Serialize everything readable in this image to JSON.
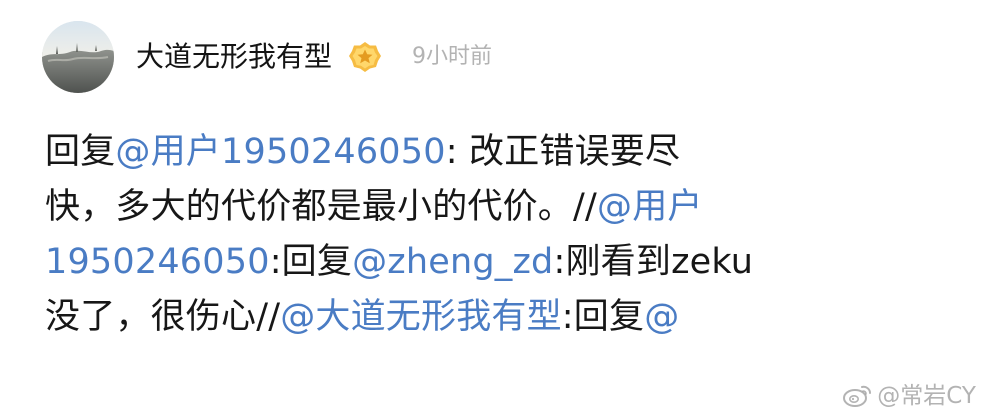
{
  "post": {
    "username": "大道无形我有型",
    "time": "9小时前",
    "badge_icon": "gold-vip-badge-icon",
    "comment_lines": [
      [
        {
          "text": "回复",
          "type": "text"
        },
        {
          "text": "@用户1950246050",
          "type": "mention"
        },
        {
          "text": ": 改正错误要尽",
          "type": "text"
        }
      ],
      [
        {
          "text": "快，多大的代价都是最小的代价。//",
          "type": "text"
        },
        {
          "text": "@用户",
          "type": "mention"
        }
      ],
      [
        {
          "text": "1950246050",
          "type": "mention"
        },
        {
          "text": ":回复",
          "type": "text"
        },
        {
          "text": "@zheng_zd",
          "type": "mention"
        },
        {
          "text": ":刚看到zeku",
          "type": "text"
        }
      ],
      [
        {
          "text": "没了，很伤心//",
          "type": "text"
        },
        {
          "text": "@大道无形我有型",
          "type": "mention"
        },
        {
          "text": ":回复",
          "type": "text"
        },
        {
          "text": "@",
          "type": "mention"
        }
      ]
    ]
  },
  "watermark": {
    "text": "@常岩CY",
    "icon": "weibo-logo-icon"
  },
  "colors": {
    "mention": "#4a7cc4",
    "text": "#171717",
    "secondary": "#b3b3b3",
    "badge": "#f4b73d"
  }
}
